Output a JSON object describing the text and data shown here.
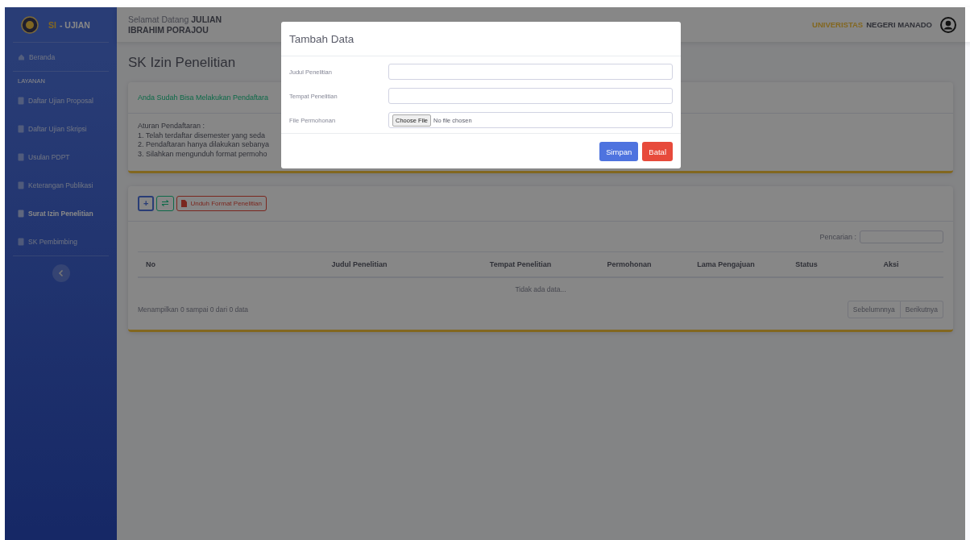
{
  "brand": {
    "prefix": "SI",
    "name": "- UJIAN"
  },
  "sidebar": {
    "items": [
      {
        "label": "Beranda",
        "selected": false
      }
    ],
    "section": "LAYANAN",
    "services": [
      {
        "label": "Daftar Ujian Proposal",
        "selected": false
      },
      {
        "label": "Daftar Ujian Skripsi",
        "selected": false
      },
      {
        "label": "Usulan PDPT",
        "selected": false
      },
      {
        "label": "Keterangan Publikasi",
        "selected": false
      },
      {
        "label": "Surat Izin Penelitian",
        "selected": true
      },
      {
        "label": "SK Pembimbing",
        "selected": false
      }
    ]
  },
  "header": {
    "greeting": "Selamat Datang **JULIAN IBRAHIM PORAJOU**",
    "university_prefix": "UNIVERISTAS",
    "university_name": "NEGERI MANADO"
  },
  "page_title": "SK Izin Penelitian",
  "notice": {
    "message": "Anda Sudah Bisa Melakukan Pendaftara",
    "rules_title": "Aturan Pendaftaran :",
    "rules": [
      "1. Telah terdaftar disemester yang seda",
      "2. Pendaftaran hanya dilakukan sebanya",
      "3. Silahkan mengunduh format permoho"
    ]
  },
  "toolbar": {
    "add": "+",
    "download": "Unduh Format Penelitian"
  },
  "table": {
    "search_label": "Pencarian :",
    "columns": [
      "No",
      "Judul Penelitian",
      "Tempat Penelitian",
      "Permohonan",
      "Lama Pengajuan",
      "Status",
      "Aksi"
    ],
    "empty": "Tidak ada data...",
    "info": "Menampilkan 0 sampai 0 dari 0 data",
    "pager": [
      "Sebelumnnya",
      "Berikutnya"
    ]
  },
  "modal": {
    "title": "Tambah Data",
    "fields": [
      {
        "label": "Judul Penelitian",
        "kind": "text"
      },
      {
        "label": "Tempat Penelitian",
        "kind": "text"
      },
      {
        "label": "File Permohonan",
        "kind": "file",
        "button": "Choose File",
        "value": "No file chosen"
      }
    ],
    "buttons": [
      {
        "label": "Simpan",
        "kind": "primary"
      },
      {
        "label": "Batal",
        "kind": "danger"
      }
    ]
  }
}
